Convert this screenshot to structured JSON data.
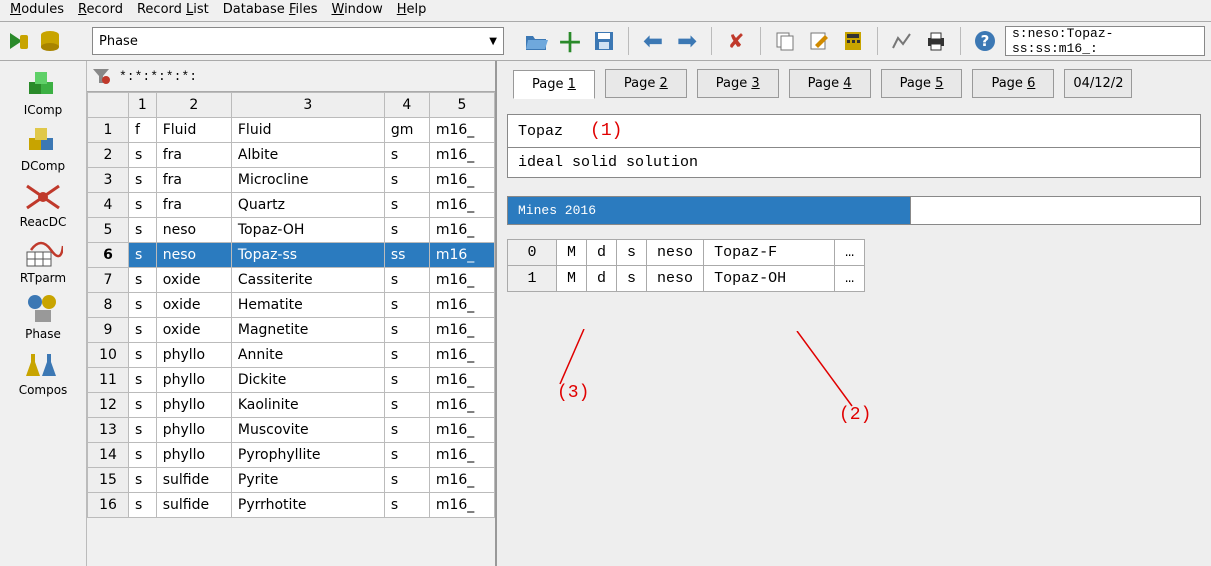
{
  "menubar": [
    "Modules",
    "Record",
    "Record List",
    "Database Files",
    "Window",
    "Help"
  ],
  "combo": "Phase",
  "pathfield": "s:neso:Topaz-ss:ss:m16_:",
  "sidebar": [
    {
      "name": "IComp"
    },
    {
      "name": "DComp"
    },
    {
      "name": "ReacDC"
    },
    {
      "name": "RTparm"
    },
    {
      "name": "Phase"
    },
    {
      "name": "Compos"
    }
  ],
  "filter_text": "*:*:*:*:*:",
  "grid_headers": [
    "1",
    "2",
    "3",
    "4",
    "5"
  ],
  "grid_rows": [
    {
      "n": "1",
      "c": [
        "f",
        "Fluid",
        "Fluid",
        "gm",
        "m16_"
      ]
    },
    {
      "n": "2",
      "c": [
        "s",
        "fra",
        "Albite",
        "s",
        "m16_"
      ]
    },
    {
      "n": "3",
      "c": [
        "s",
        "fra",
        "Microcline",
        "s",
        "m16_"
      ]
    },
    {
      "n": "4",
      "c": [
        "s",
        "fra",
        "Quartz",
        "s",
        "m16_"
      ]
    },
    {
      "n": "5",
      "c": [
        "s",
        "neso",
        "Topaz-OH",
        "s",
        "m16_"
      ]
    },
    {
      "n": "6",
      "c": [
        "s",
        "neso",
        "Topaz-ss",
        "ss",
        "m16_"
      ],
      "sel": true
    },
    {
      "n": "7",
      "c": [
        "s",
        "oxide",
        "Cassiterite",
        "s",
        "m16_"
      ]
    },
    {
      "n": "8",
      "c": [
        "s",
        "oxide",
        "Hematite",
        "s",
        "m16_"
      ]
    },
    {
      "n": "9",
      "c": [
        "s",
        "oxide",
        "Magnetite",
        "s",
        "m16_"
      ]
    },
    {
      "n": "10",
      "c": [
        "s",
        "phyllo",
        "Annite",
        "s",
        "m16_"
      ]
    },
    {
      "n": "11",
      "c": [
        "s",
        "phyllo",
        "Dickite",
        "s",
        "m16_"
      ]
    },
    {
      "n": "12",
      "c": [
        "s",
        "phyllo",
        "Kaolinite",
        "s",
        "m16_"
      ]
    },
    {
      "n": "13",
      "c": [
        "s",
        "phyllo",
        "Muscovite",
        "s",
        "m16_"
      ]
    },
    {
      "n": "14",
      "c": [
        "s",
        "phyllo",
        "Pyrophyllite",
        "s",
        "m16_"
      ]
    },
    {
      "n": "15",
      "c": [
        "s",
        "sulfide",
        "Pyrite",
        "s",
        "m16_"
      ]
    },
    {
      "n": "16",
      "c": [
        "s",
        "sulfide",
        "Pyrrhotite",
        "s",
        "m16_"
      ]
    }
  ],
  "tabs": [
    "Page 1",
    "Page 2",
    "Page 3",
    "Page 4",
    "Page 5",
    "Page 6"
  ],
  "date_partial": "04/12/2",
  "detail": {
    "name": "Topaz",
    "desc": "ideal solid solution",
    "source": "Mines 2016"
  },
  "endmembers": [
    {
      "i": "0",
      "c": [
        "M",
        "d",
        "s",
        "neso",
        "Topaz-F",
        "…"
      ]
    },
    {
      "i": "1",
      "c": [
        "M",
        "d",
        "s",
        "neso",
        "Topaz-OH",
        "…"
      ]
    }
  ],
  "annotations": {
    "a1": "(1)",
    "a2": "(2)",
    "a3": "(3)"
  }
}
